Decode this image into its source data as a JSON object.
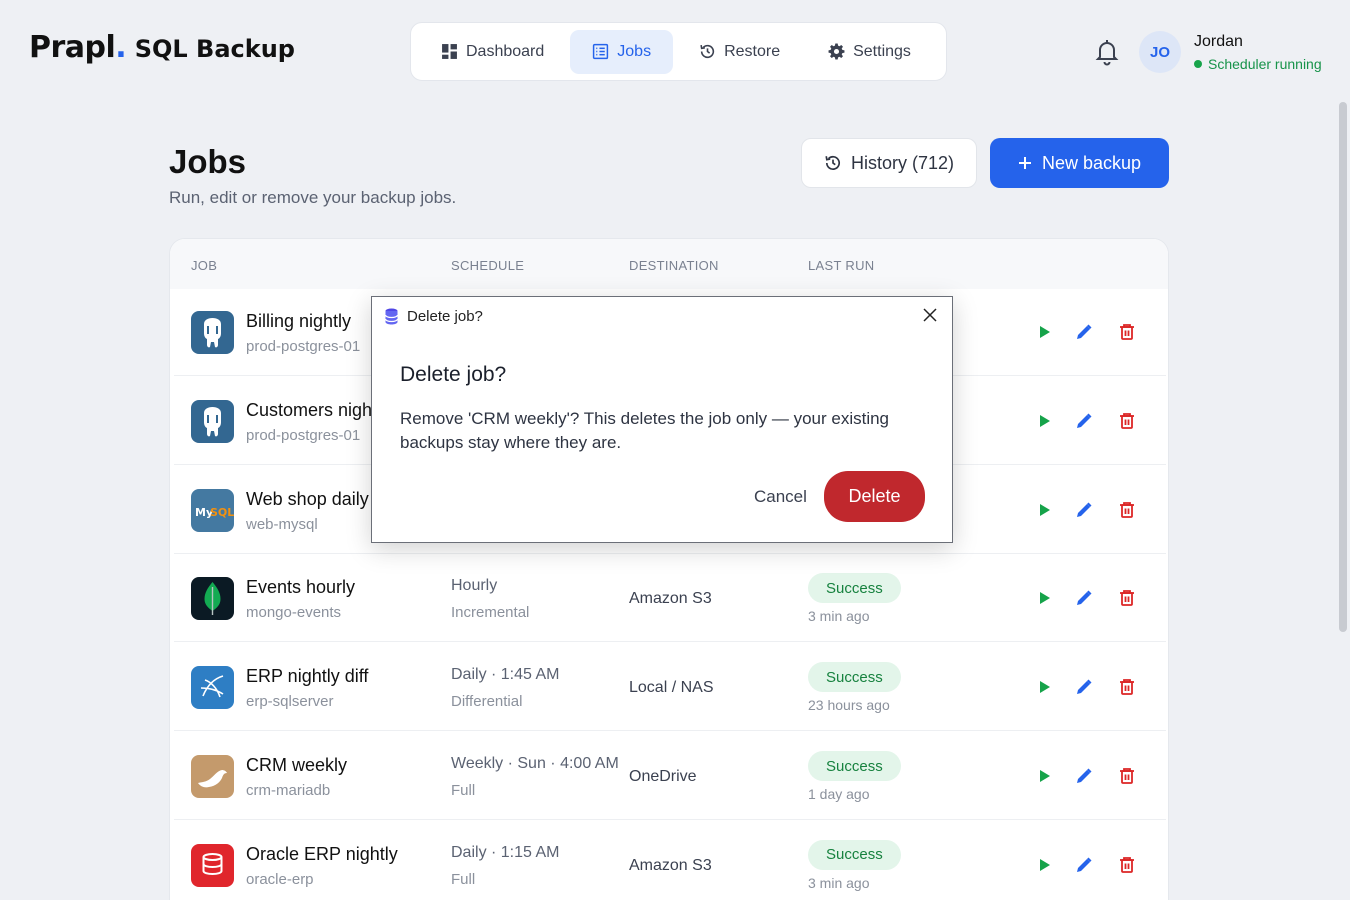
{
  "brand": {
    "main": "Prapl",
    "dot": ".",
    "sub": "SQL Backup"
  },
  "nav": {
    "dashboard": "Dashboard",
    "jobs": "Jobs",
    "restore": "Restore",
    "settings": "Settings",
    "active": "Jobs"
  },
  "user": {
    "initials": "JO",
    "name": "Jordan",
    "status": "Scheduler running"
  },
  "page": {
    "title": "Jobs",
    "subtitle": "Run, edit or remove your backup jobs.",
    "history_label": "History (712)",
    "new_backup_label": "New backup"
  },
  "table": {
    "headers": {
      "job": "JOB",
      "schedule": "SCHEDULE",
      "destination": "DESTINATION",
      "last_run": "LAST RUN"
    },
    "rows": [
      {
        "name": "Billing nightly",
        "host": "prod-postgres-01",
        "schedule": "",
        "type": "",
        "destination": "",
        "status": "",
        "ago": "",
        "icon": "postgres-icon"
      },
      {
        "name": "Customers nightly",
        "host": "prod-postgres-01",
        "schedule": "",
        "type": "",
        "destination": "",
        "status": "",
        "ago": "",
        "icon": "postgres-icon"
      },
      {
        "name": "Web shop daily",
        "host": "web-mysql",
        "schedule": "",
        "type": "",
        "destination": "",
        "status": "",
        "ago": "",
        "icon": "mysql-icon"
      },
      {
        "name": "Events hourly",
        "host": "mongo-events",
        "schedule": "Hourly",
        "type": "Incremental",
        "destination": "Amazon S3",
        "status": "Success",
        "ago": "3 min ago",
        "icon": "mongodb-icon"
      },
      {
        "name": "ERP nightly diff",
        "host": "erp-sqlserver",
        "schedule": "Daily · 1:45 AM",
        "type": "Differential",
        "destination": "Local / NAS",
        "status": "Success",
        "ago": "23 hours ago",
        "icon": "sqlserver-icon"
      },
      {
        "name": "CRM weekly",
        "host": "crm-mariadb",
        "schedule": "Weekly · Sun · 4:00 AM",
        "type": "Full",
        "destination": "OneDrive",
        "status": "Success",
        "ago": "1 day ago",
        "icon": "mariadb-icon"
      },
      {
        "name": "Oracle ERP nightly",
        "host": "oracle-erp",
        "schedule": "Daily · 1:15 AM",
        "type": "Full",
        "destination": "Amazon S3",
        "status": "Success",
        "ago": "3 min ago",
        "icon": "oracle-icon"
      }
    ]
  },
  "dialog": {
    "window_title": "Delete job?",
    "heading": "Delete job?",
    "message": "Remove 'CRM weekly'? This deletes the job only — your existing backups stay where they are.",
    "cancel_label": "Cancel",
    "delete_label": "Delete"
  },
  "colors": {
    "accent": "#2563eb",
    "danger": "#c0282d",
    "success": "#17823f",
    "run": "#16a34a",
    "background": "#eef0f4"
  }
}
